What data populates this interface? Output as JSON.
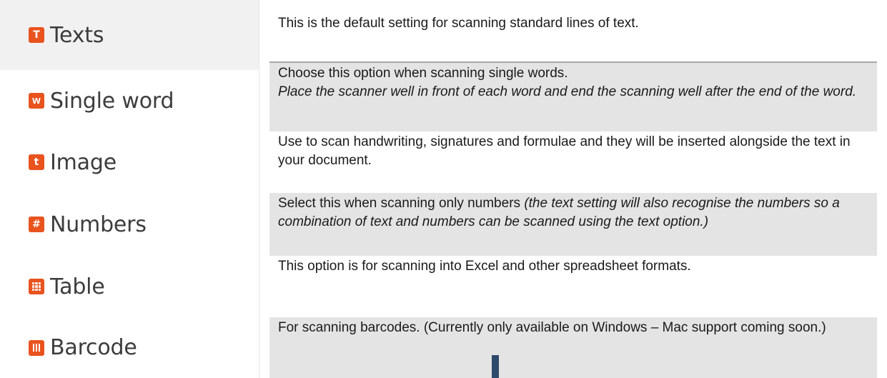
{
  "menu": {
    "items": [
      {
        "label": "Texts",
        "icon": "T",
        "icon_name": "text-mode-icon",
        "selected": true
      },
      {
        "label": "Single word",
        "icon": "W",
        "icon_name": "single-word-mode-icon",
        "selected": false
      },
      {
        "label": "Image",
        "icon": "t",
        "icon_name": "image-mode-icon",
        "selected": false
      },
      {
        "label": "Numbers",
        "icon": "#",
        "icon_name": "numbers-mode-icon",
        "selected": false
      },
      {
        "label": "Table",
        "icon": "",
        "icon_name": "table-mode-icon",
        "selected": false
      },
      {
        "label": "Barcode",
        "icon": "",
        "icon_name": "barcode-mode-icon",
        "selected": false
      }
    ],
    "accent_color": "#e8531e",
    "selected_background": "#f1f1f1"
  },
  "descriptions": {
    "texts": {
      "text": "This is the default setting for scanning standard lines of text."
    },
    "single_word": {
      "text": "Choose this option when scanning single words.",
      "italic": "Place the scanner well in front of each word and end the scanning well after the end of the word."
    },
    "image": {
      "text": "Use to scan handwriting, signatures and formulae and they will be inserted alongside the text in your document."
    },
    "numbers": {
      "text": "Select this when scanning only numbers ",
      "italic": "(the text setting will also recognise the numbers so a combination of text and numbers can be scanned using the text option.)"
    },
    "table": {
      "text": "This option is for scanning into Excel and other spreadsheet formats."
    },
    "barcode": {
      "text": "For scanning barcodes. (Currently only available on Windows – Mac support coming soon.)"
    },
    "shade_color": "#e4e4e4"
  }
}
